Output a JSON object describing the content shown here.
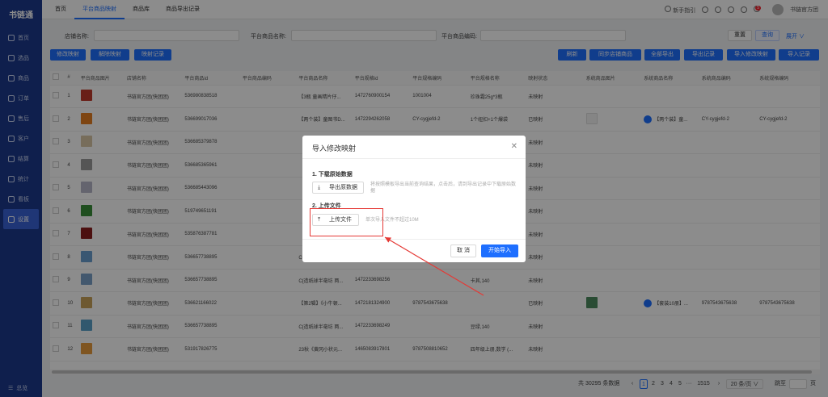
{
  "app": {
    "logo": "书链通"
  },
  "sidebar": {
    "items": [
      {
        "label": "首页"
      },
      {
        "label": "选品"
      },
      {
        "label": "商品"
      },
      {
        "label": "订单"
      },
      {
        "label": "售后"
      },
      {
        "label": "客户"
      },
      {
        "label": "结算"
      },
      {
        "label": "统计"
      },
      {
        "label": "看板"
      },
      {
        "label": "设置"
      }
    ],
    "bottom": "总览"
  },
  "topbar": {
    "tabs": [
      {
        "label": "首页"
      },
      {
        "label": "平台商品映射"
      },
      {
        "label": "商品库"
      },
      {
        "label": "商品导出记录"
      }
    ],
    "guide": "新手指引",
    "badge": "5",
    "shop": "书链官方团"
  },
  "filter": {
    "shop_label": "店铺名称:",
    "name_label": "平台商品名称:",
    "code_label": "平台商品编码:",
    "reset": "重置",
    "query": "查询",
    "expand": "展开 ∨"
  },
  "actions": {
    "left": [
      "修改映射",
      "解除映射",
      "映射记录"
    ],
    "right": [
      "刷新",
      "同步店铺商品",
      "全部导出",
      "导出记录",
      "导入修改映射",
      "导入记录"
    ]
  },
  "table": {
    "columns": [
      "#",
      "平台商品图片",
      "店铺名称",
      "平台商品id",
      "平台商品编码",
      "平台商品名称",
      "平台规格id",
      "平台规格编码",
      "平台规格名称",
      "映射状态",
      "系统商品图片",
      "系统商品名称",
      "系统商品编码",
      "系统规格编码"
    ],
    "rows": [
      {
        "n": "1",
        "shop": "书链官方团(快团团)",
        "pid": "536980838518",
        "pcode": "",
        "pname": "【3瓶 童画精片仔...",
        "sid": "1472760900154",
        "scode": "1001004",
        "sname": "珍珠霜25g*3瓶",
        "status": "未映射",
        "sysname": "",
        "syscode": "",
        "sysspec": ""
      },
      {
        "n": "2",
        "shop": "书链官方团(快团团)",
        "pid": "536699017036",
        "pcode": "",
        "pname": "【两个装】童图书D...",
        "sid": "1472294262058",
        "scode": "CY-cygjefd-2",
        "sname": "1个纽扣+1个爆袋",
        "status": "已映射",
        "sysname": "【两个装】童...",
        "syscode": "CY-cygjefd-2",
        "sysspec": "CY-cygjefd-2"
      },
      {
        "n": "3",
        "shop": "书链官方团(快团团)",
        "pid": "536685379878",
        "pcode": "",
        "pname": "",
        "sid": "",
        "scode": "",
        "sname": "",
        "status": "未映射",
        "sysname": "",
        "syscode": "",
        "sysspec": ""
      },
      {
        "n": "4",
        "shop": "书链官方团(快团团)",
        "pid": "536685365961",
        "pcode": "",
        "pname": "",
        "sid": "",
        "scode": "",
        "sname": "",
        "status": "未映射",
        "sysname": "",
        "syscode": "",
        "sysspec": ""
      },
      {
        "n": "5",
        "shop": "书链官方团(快团团)",
        "pid": "536685443096",
        "pcode": "",
        "pname": "",
        "sid": "",
        "scode": "",
        "sname": "",
        "status": "未映射",
        "sysname": "",
        "syscode": "",
        "sysspec": ""
      },
      {
        "n": "6",
        "shop": "书链官方团(快团团)",
        "pid": "519749651191",
        "pcode": "",
        "pname": "",
        "sid": "",
        "scode": "",
        "sname": "",
        "status": "未映射",
        "sysname": "",
        "syscode": "",
        "sysspec": ""
      },
      {
        "n": "7",
        "shop": "书链官方团(快团团)",
        "pid": "535876387781",
        "pcode": "",
        "pname": "",
        "sid": "",
        "scode": "",
        "sname": "",
        "status": "未映射",
        "sysname": "",
        "syscode": "",
        "sysspec": ""
      },
      {
        "n": "8",
        "shop": "书链官方团(快团团)",
        "pid": "536657738895",
        "pcode": "",
        "pname": "C{造纸球半毫坊 两...",
        "sid": "1472233698208",
        "scode": "",
        "sname": "蓝色,150",
        "status": "未映射",
        "sysname": "",
        "syscode": "",
        "sysspec": ""
      },
      {
        "n": "9",
        "shop": "书链官方团(快团团)",
        "pid": "536657738895",
        "pcode": "",
        "pname": "C{造纸球半毫坊 两...",
        "sid": "1472233698256",
        "scode": "",
        "sname": "卡其,140",
        "status": "未映射",
        "sysname": "",
        "syscode": "",
        "sysspec": ""
      },
      {
        "n": "10",
        "shop": "书链官方团(快团团)",
        "pid": "536621166022",
        "pcode": "",
        "pname": "【第2辑】《小牛顿...",
        "sid": "1472181324900",
        "scode": "9787543675638",
        "sname": "",
        "status": "已映射",
        "sysname": "【套装10册】...",
        "syscode": "9787543675638",
        "sysspec": "9787543675638"
      },
      {
        "n": "11",
        "shop": "书链官方团(快团团)",
        "pid": "536657738895",
        "pcode": "",
        "pname": "C{造纸球半毫坊 两...",
        "sid": "1472233698249",
        "scode": "",
        "sname": "豆绿,140",
        "status": "未映射",
        "sysname": "",
        "syscode": "",
        "sysspec": ""
      },
      {
        "n": "12",
        "shop": "书链官方团(快团团)",
        "pid": "531917826775",
        "pcode": "",
        "pname": "23秋《黄冈小状元...",
        "sid": "1465083917801",
        "scode": "9787508810652",
        "sname": "四年级上册,数学 (...",
        "status": "未映射",
        "sysname": "",
        "syscode": "",
        "sysspec": ""
      }
    ]
  },
  "pagination": {
    "total": "共 30295 条数据",
    "pages": [
      "1",
      "2",
      "3",
      "4",
      "5",
      "···",
      "1515"
    ],
    "size": "20 条/页 ∨",
    "jump": "跳至",
    "page_unit": "页"
  },
  "modal": {
    "title": "导入修改映射",
    "step1": "1. 下载原始数据",
    "export_btn": "导出原数据",
    "hint1": "将按照模板导出当前查询结果，点击后，请到导出记录中下载原始数据",
    "step2": "2. 上传文件",
    "upload_btn": "上传文件",
    "hint2": "单次导入文件不超过10M",
    "cancel": "取 消",
    "start": "开始导入"
  },
  "colors": {
    "primary": "#1e6fff",
    "sidebar": "#1d3a8c",
    "annotation": "#e53935"
  }
}
